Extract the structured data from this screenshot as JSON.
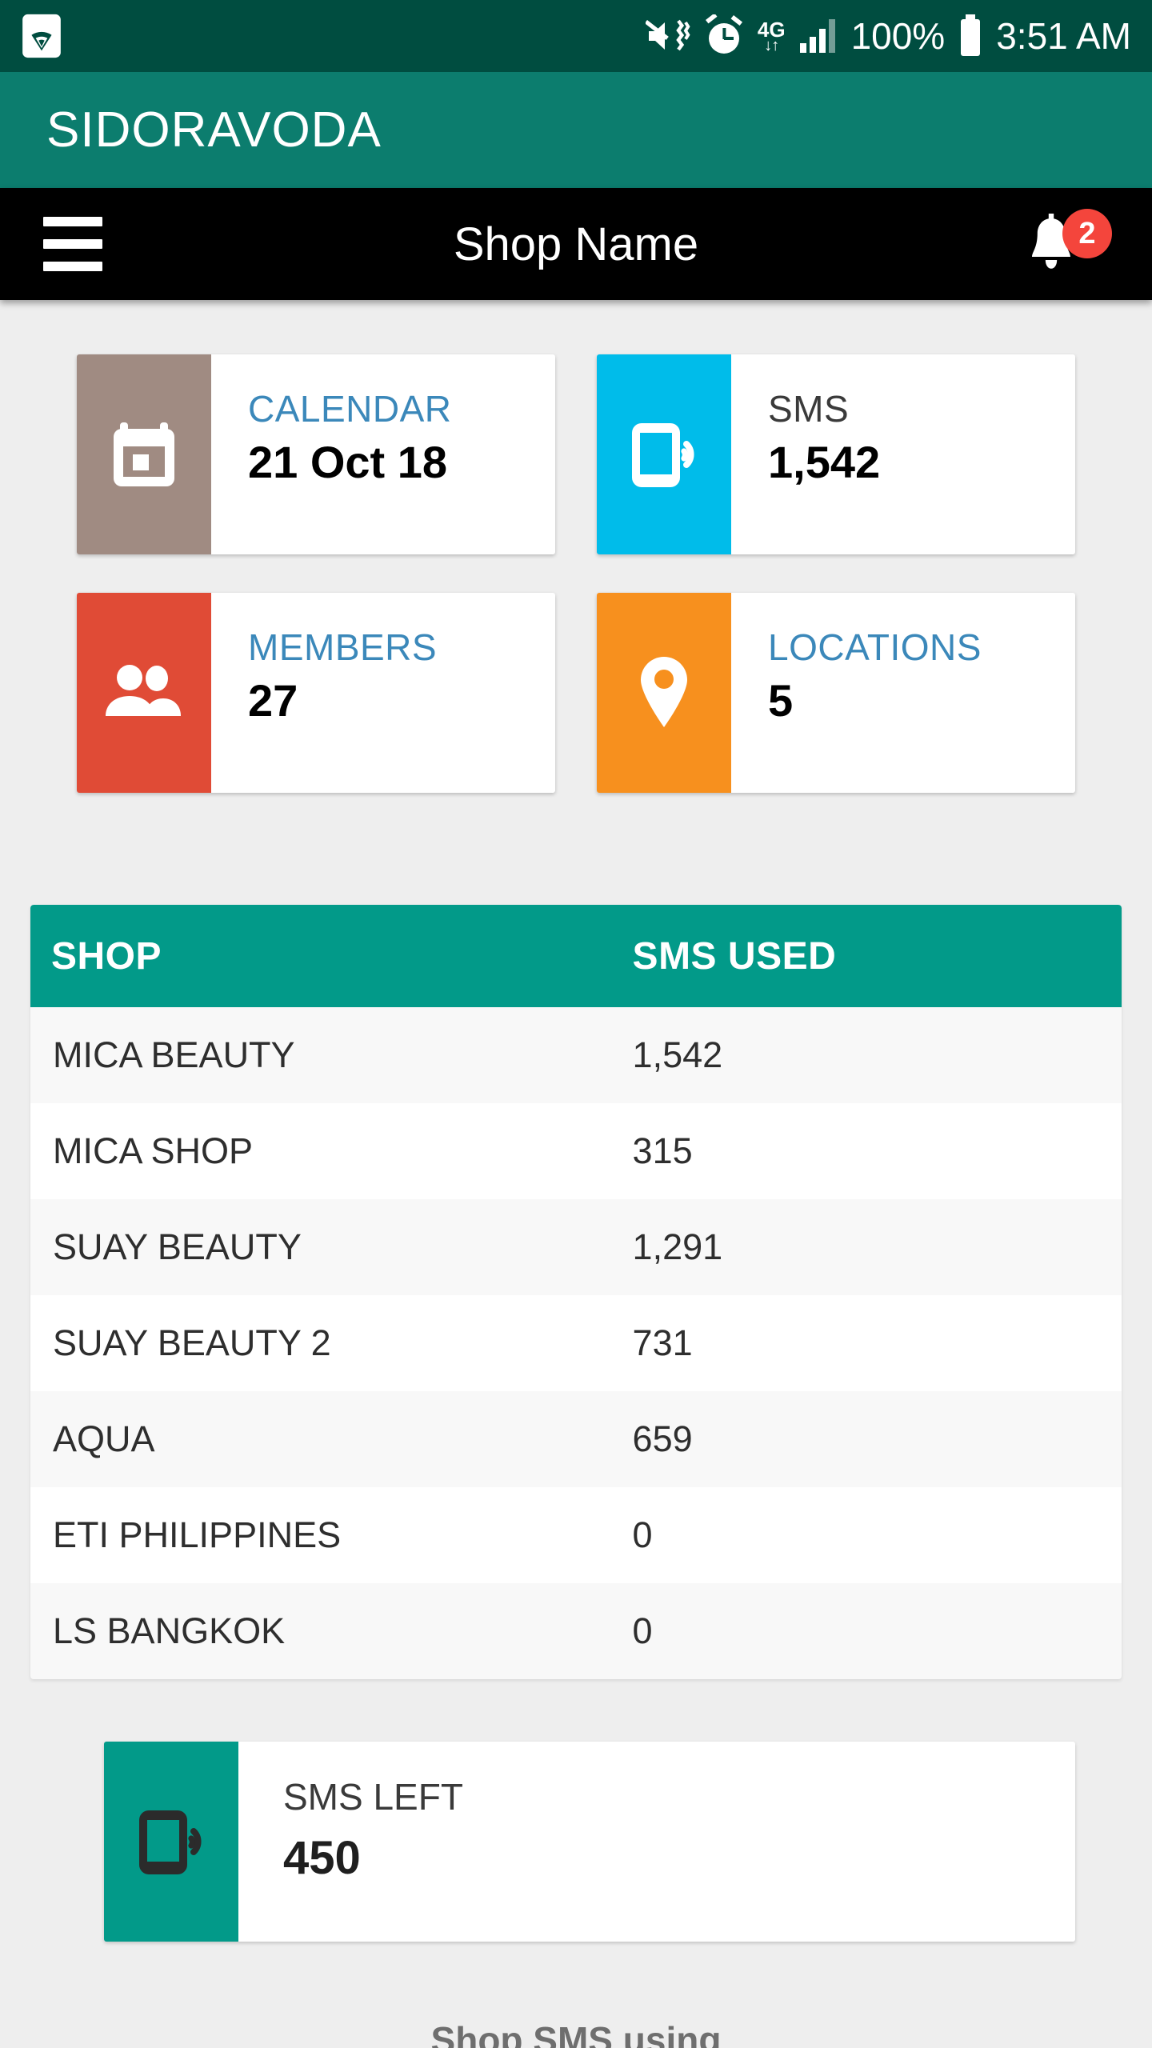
{
  "status_bar": {
    "wifi_icon": "wifi-icon",
    "mute_icon": "mute-vibrate-icon",
    "alarm_icon": "alarm-clock-icon",
    "network_label": "4G",
    "network_arrows": "↓↑",
    "signal_icon": "signal-bars-icon",
    "battery_percent": "100%",
    "battery_icon": "battery-full-icon",
    "time": "3:51 AM"
  },
  "brand_bar": {
    "title": "SIDORAVODA",
    "background": "#0c7d6e"
  },
  "toolbar": {
    "menu_icon": "hamburger-menu-icon",
    "title": "Shop Name",
    "notification_icon": "bell-icon",
    "notification_count": "2",
    "badge_color": "#f4453c",
    "background": "#000000"
  },
  "cards": [
    {
      "name": "calendar",
      "label": "CALENDAR",
      "value": "21 Oct 18",
      "icon": "calendar-icon",
      "color": "#a08b82",
      "label_color": "#3b88ba"
    },
    {
      "name": "sms",
      "label": "SMS",
      "value": "1,542",
      "icon": "phone-sms-icon",
      "color": "#00bcea",
      "label_color": "#3a3a3a"
    },
    {
      "name": "members",
      "label": "MEMBERS",
      "value": "27",
      "icon": "people-icon",
      "color": "#e04b36",
      "label_color": "#3b88ba"
    },
    {
      "name": "locations",
      "label": "LOCATIONS",
      "value": "5",
      "icon": "map-pin-icon",
      "color": "#f7901e",
      "label_color": "#3b88ba"
    }
  ],
  "table": {
    "header_color": "#029a89",
    "columns": [
      "SHOP",
      "SMS USED"
    ],
    "rows": [
      {
        "shop": "MICA BEAUTY",
        "sms_used": "1,542"
      },
      {
        "shop": "MICA SHOP",
        "sms_used": "315"
      },
      {
        "shop": "SUAY BEAUTY",
        "sms_used": "1,291"
      },
      {
        "shop": "SUAY BEAUTY 2",
        "sms_used": "731"
      },
      {
        "shop": "AQUA",
        "sms_used": "659"
      },
      {
        "shop": "ETI PHILIPPINES",
        "sms_used": "0"
      },
      {
        "shop": "LS BANGKOK",
        "sms_used": "0"
      }
    ]
  },
  "sms_left_card": {
    "label": "SMS LEFT",
    "value": "450",
    "icon": "phone-sms-icon",
    "color": "#029a89"
  },
  "footer": {
    "partial_text": "Shop SMS using"
  }
}
